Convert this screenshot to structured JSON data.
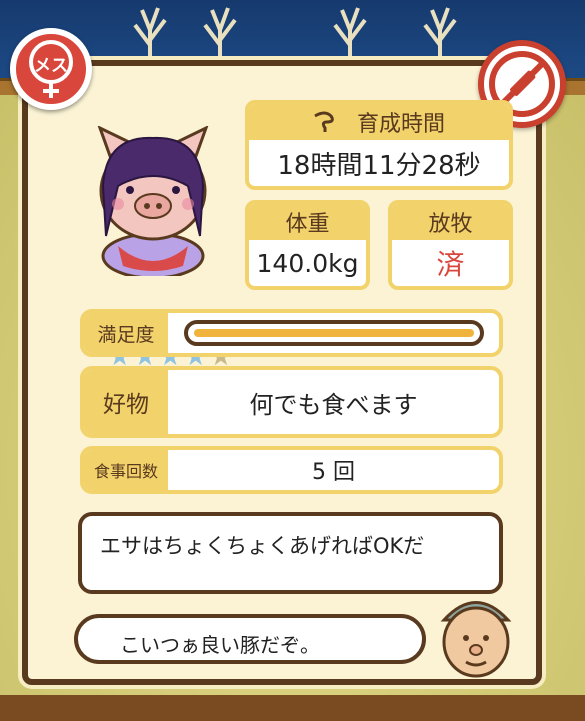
{
  "panel": {
    "growth_time": {
      "label": "育成時間",
      "value": "18時間11分28秒"
    },
    "weight": {
      "label": "体重",
      "value": "140.0kg"
    },
    "grazing": {
      "label": "放牧",
      "value": "済"
    },
    "rating": {
      "filled": 4,
      "total": 5
    },
    "satisfaction": {
      "label": "満足度",
      "level_percent": 100
    },
    "favorite": {
      "label": "好物",
      "value": "何でも食べます"
    },
    "meals": {
      "label": "食事回数",
      "value": "5 回"
    }
  },
  "badges": {
    "gender": "メス",
    "no_medicine_icon": "syringe-prohibited-icon"
  },
  "dialogue": {
    "line1": "エサはちょくちょくあげればOKだ",
    "line2": "こいつぁ良い豚だぞ。"
  },
  "colors": {
    "accent_yellow": "#f2d26a",
    "frame_brown": "#5a3a1f",
    "grazing_red": "#d9463c",
    "star_filled": "#8fc3e0",
    "star_empty": "#c9b98a",
    "bar_fill": "#f0b43c"
  }
}
